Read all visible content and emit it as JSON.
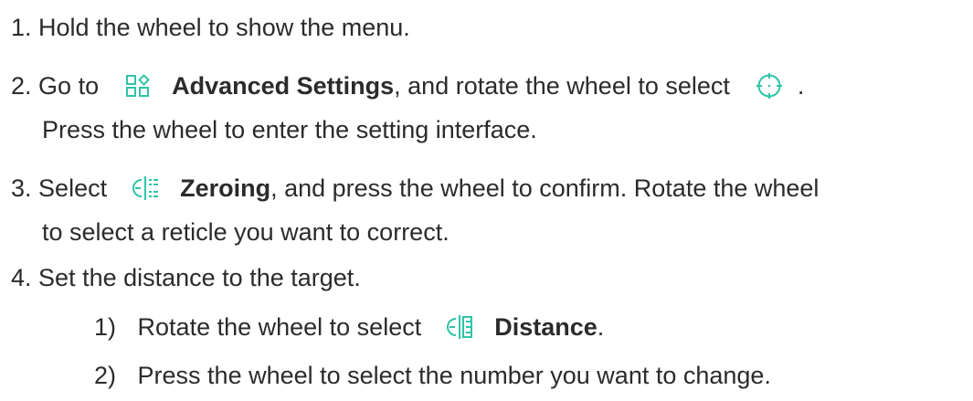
{
  "accent_color": "#2ec4a6",
  "steps": [
    {
      "number": "1.",
      "text": "Hold the wheel to show the menu."
    },
    {
      "number": "2.",
      "pre": "Go to",
      "icon": "advanced-settings-icon",
      "bold": "Advanced Settings",
      "post": ", and rotate the wheel to select",
      "icon2": "crosshair-icon",
      "end": ".",
      "line2": "Press the wheel to enter the setting interface."
    },
    {
      "number": "3.",
      "pre": "Select",
      "icon": "zeroing-icon",
      "bold": "Zeroing",
      "post": ", and press the wheel to confirm. Rotate the wheel",
      "line2": "to select a reticle you want to correct."
    },
    {
      "number": "4.",
      "text": "Set the distance to the target.",
      "substeps": [
        {
          "number": "1)",
          "pre": "Rotate the wheel to select",
          "icon": "distance-icon",
          "bold": "Distance",
          "end": "."
        },
        {
          "number": "2)",
          "text": "Press the wheel to select the number you want to change."
        }
      ]
    }
  ]
}
